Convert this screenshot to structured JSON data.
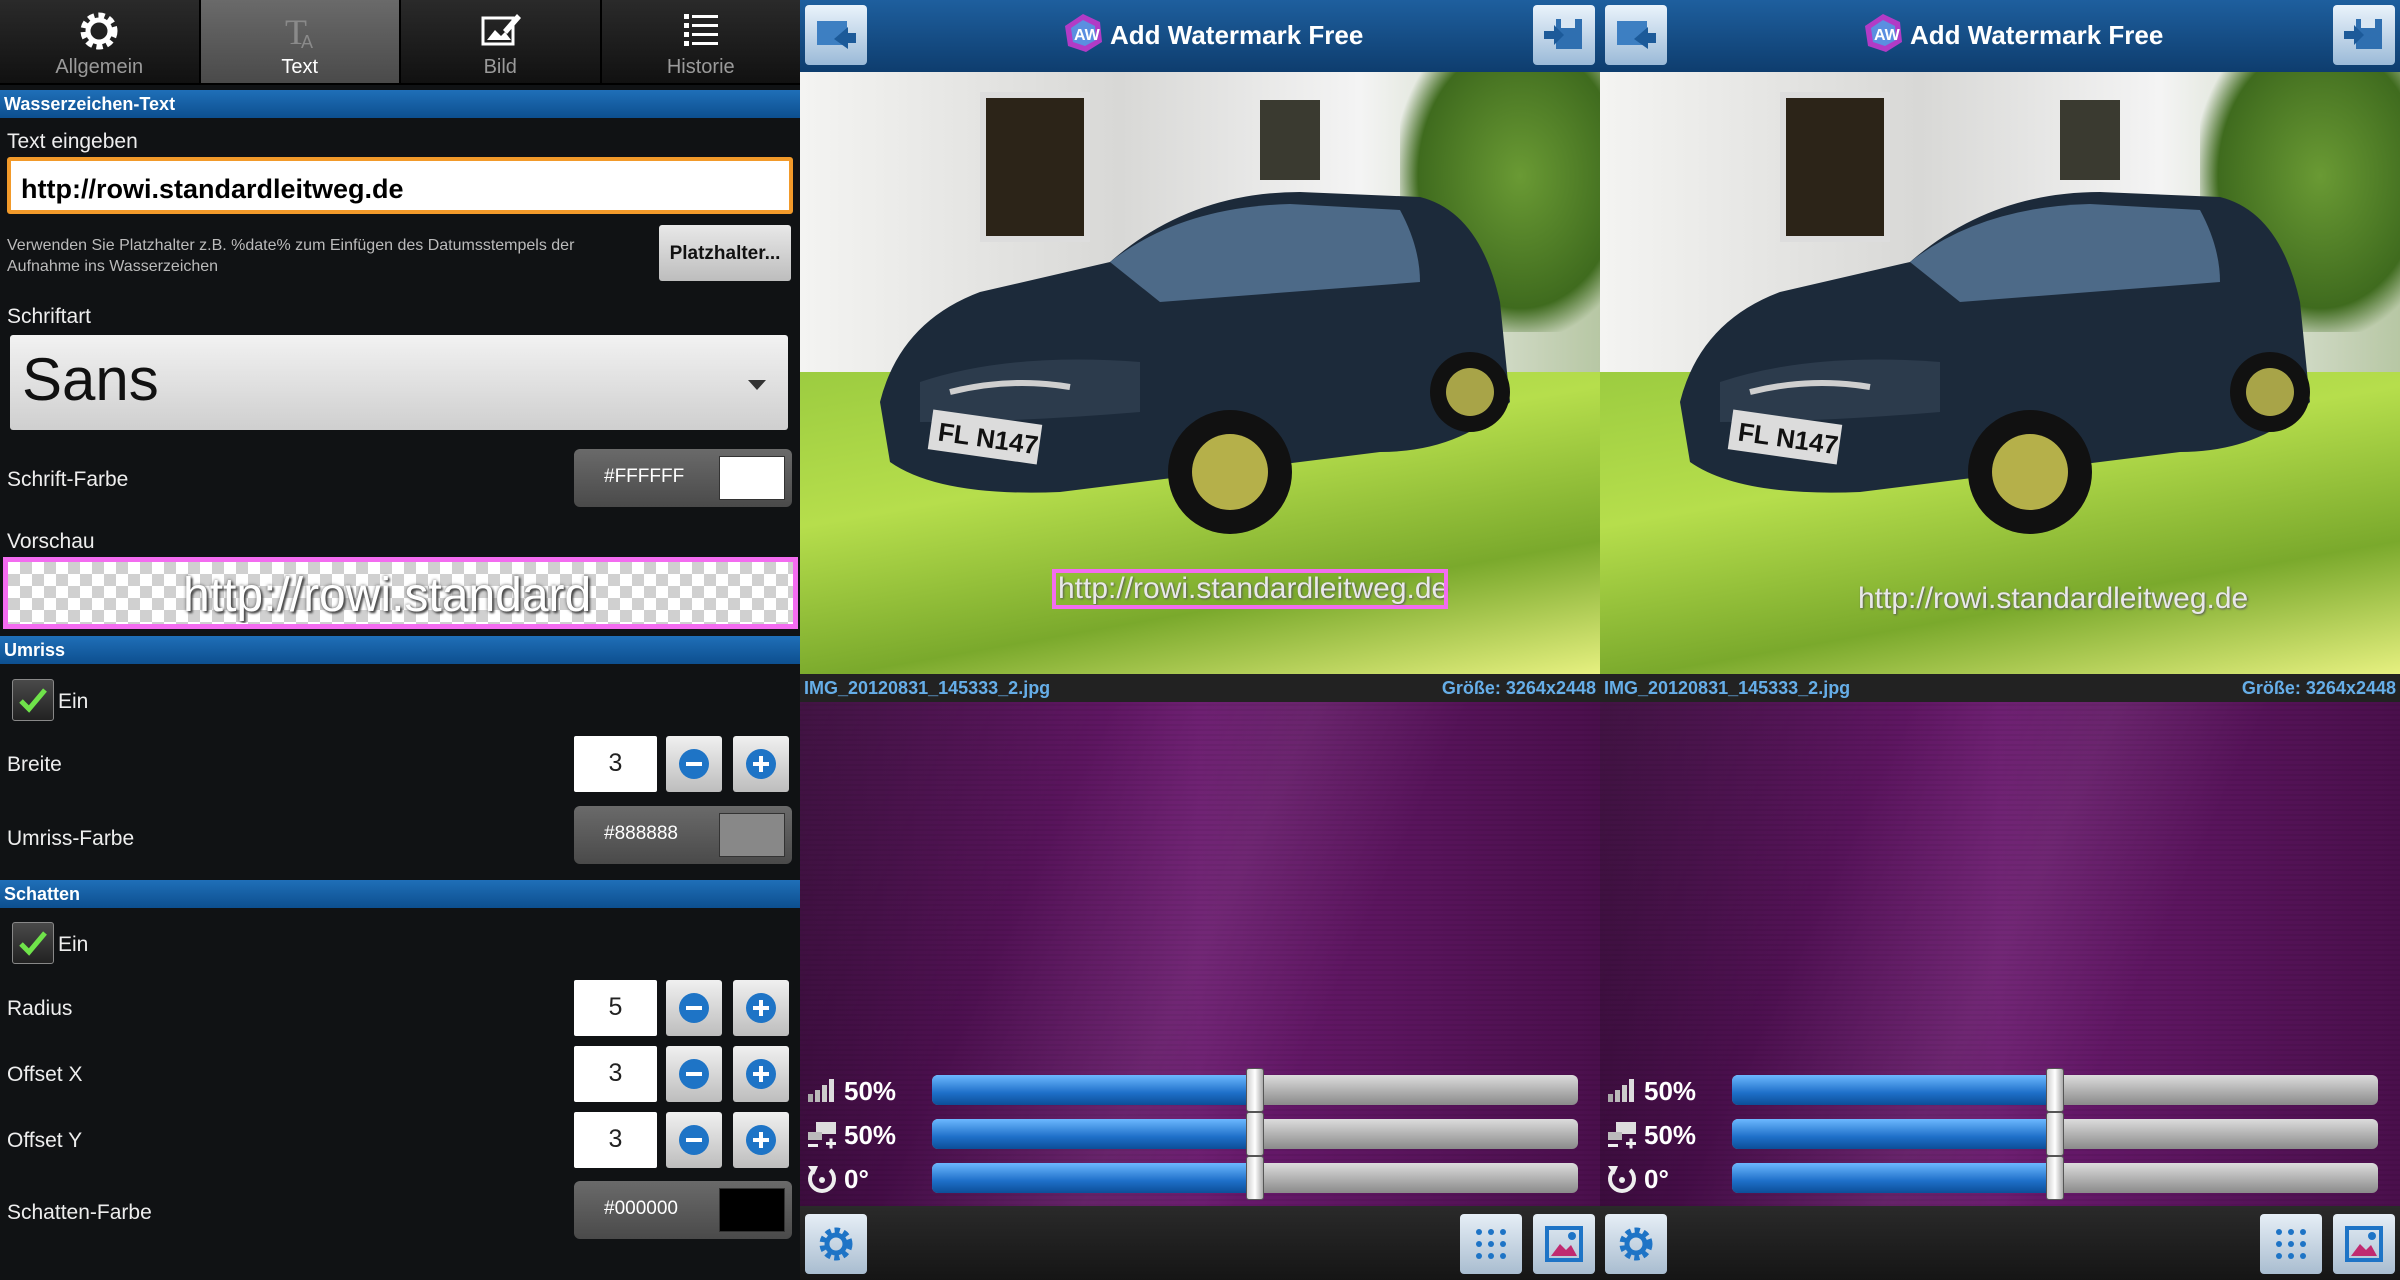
{
  "tabs": [
    {
      "label": "Allgemein",
      "icon": "gear-icon",
      "active": false
    },
    {
      "label": "Text",
      "icon": "text-icon",
      "active": true
    },
    {
      "label": "Bild",
      "icon": "image-edit-icon",
      "active": false
    },
    {
      "label": "Historie",
      "icon": "list-icon",
      "active": false
    }
  ],
  "watermark_text": {
    "section": "Wasserzeichen-Text",
    "input_label": "Text eingeben",
    "value": "http://rowi.standardleitweg.de",
    "hint": "Verwenden Sie Platzhalter z.B. %date% zum Einfügen des Datumsstempels der Aufnahme ins Wasserzeichen",
    "placeholder_button": "Platzhalter...",
    "font_label": "Schriftart",
    "font_value": "Sans",
    "font_color_label": "Schrift-Farbe",
    "font_color": "#FFFFFF",
    "preview_label": "Vorschau",
    "preview_text": "http://rowi.standard"
  },
  "outline": {
    "section": "Umriss",
    "enabled_label": "Ein",
    "enabled": true,
    "width_label": "Breite",
    "width": "3",
    "color_label": "Umriss-Farbe",
    "color": "#888888"
  },
  "shadow": {
    "section": "Schatten",
    "enabled_label": "Ein",
    "enabled": true,
    "radius_label": "Radius",
    "radius": "5",
    "offset_x_label": "Offset X",
    "offset_x": "3",
    "offset_y_label": "Offset Y",
    "offset_y": "3",
    "color_label": "Schatten-Farbe",
    "color": "#000000"
  },
  "app": {
    "title": "Add Watermark Free",
    "file_name": "IMG_20120831_145333_2.jpg",
    "file_size": "Größe: 3264x2448",
    "watermark_overlay": "http://rowi.standardleitweg.de",
    "sliders": [
      {
        "icon": "opacity-icon",
        "value_text": "50%",
        "value": 0.5
      },
      {
        "icon": "size-icon",
        "value_text": "50%",
        "value": 0.5
      },
      {
        "icon": "rotate-icon",
        "value_text": "0°",
        "value": 0.5
      }
    ]
  },
  "colors": {
    "accent": "#1f6fb8",
    "highlight_border": "#f36cf0",
    "input_border": "#f29a2a"
  }
}
